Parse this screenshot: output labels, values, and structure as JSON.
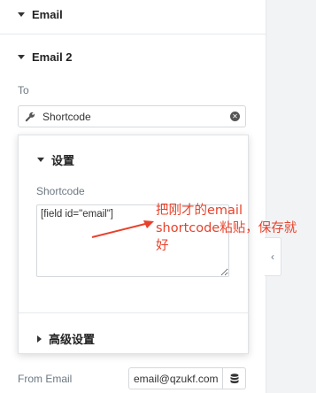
{
  "sections": {
    "email": {
      "title": "Email"
    },
    "email2": {
      "title": "Email 2"
    }
  },
  "to": {
    "label": "To",
    "dynamic_tag": "Shortcode"
  },
  "popover": {
    "settings_title": "设置",
    "shortcode_label": "Shortcode",
    "shortcode_value": "[field id=\"email\"]",
    "advanced_title": "高级设置"
  },
  "annotation": {
    "text": "把刚才的email shortcode粘贴，保存就好",
    "color": "#e8412b"
  },
  "from_email": {
    "label": "From Email",
    "value": "email@qzukf.com"
  },
  "icons": {
    "wrench": "wrench-icon",
    "clear": "close-circle-icon",
    "database": "database-icon",
    "collapse": "chevron-left-icon"
  }
}
